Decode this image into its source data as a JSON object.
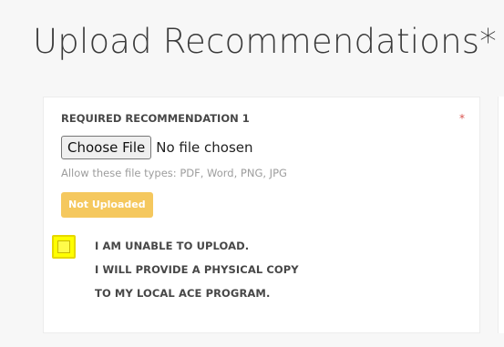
{
  "page": {
    "title": "Upload Recommendations*"
  },
  "card": {
    "label": "REQUIRED RECOMMENDATION 1",
    "required_marker": "*",
    "file_input": {
      "button_label": "Choose File",
      "status_text": "No file chosen"
    },
    "allowed_types": "Allow these file types: PDF, Word, PNG, JPG",
    "status_badge": "Not Uploaded",
    "unable_checkbox": {
      "checked": false,
      "label_lines": [
        "I AM UNABLE TO UPLOAD.",
        "I WILL PROVIDE A PHYSICAL COPY",
        "TO MY LOCAL ACE PROGRAM."
      ]
    }
  },
  "colors": {
    "badge_bg": "#f5c85e",
    "required_star": "#d9534f",
    "checkbox_highlight": "#ffff00"
  }
}
